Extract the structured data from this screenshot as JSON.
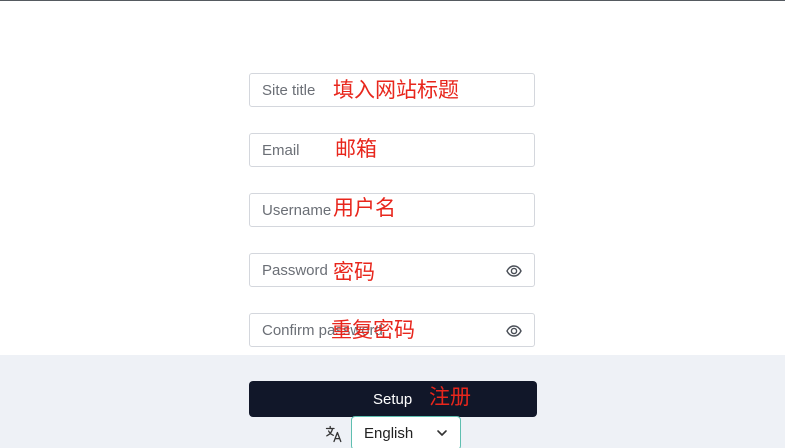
{
  "form": {
    "site_title": {
      "placeholder": "Site title",
      "annotation": "填入网站标题"
    },
    "email": {
      "placeholder": "Email",
      "annotation": "邮箱"
    },
    "username": {
      "placeholder": "Username",
      "annotation": "用户名"
    },
    "password": {
      "placeholder": "Password",
      "annotation": "密码",
      "icon": "eye-icon"
    },
    "confirm_password": {
      "placeholder": "Confirm password",
      "annotation": "重复密码",
      "icon": "eye-icon"
    }
  },
  "setup_button": {
    "label": "Setup",
    "annotation": "注册"
  },
  "language": {
    "icon": "translate-icon",
    "selected": "English",
    "chevron": "chevron-down-icon"
  },
  "colors": {
    "button_bg": "#111729",
    "annotation_red": "#e8261c",
    "footer_bg": "#eef1f6",
    "select_border": "#5fbfb0"
  }
}
